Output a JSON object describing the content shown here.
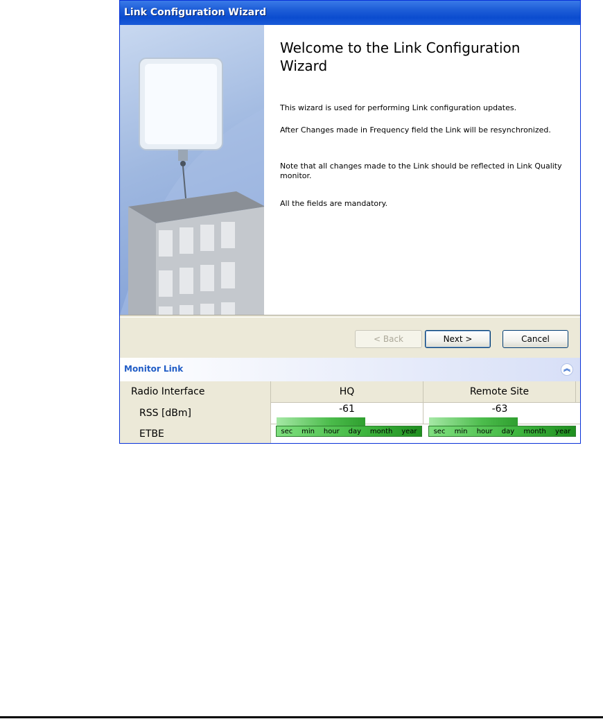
{
  "window": {
    "title": "Link Configuration Wizard"
  },
  "wizard": {
    "heading": "Welcome to the Link Configuration Wizard",
    "paragraphs": [
      "This wizard is used for performing Link configuration updates.",
      "After Changes made in Frequency field the Link will be resynchronized.",
      "Note that all changes made to the Link should be reflected in Link Quality monitor.",
      "All the fields are mandatory."
    ]
  },
  "buttons": {
    "back": "< Back",
    "next": "Next >",
    "cancel": "Cancel"
  },
  "monitor": {
    "title": "Monitor Link",
    "collapse_icon": "double-chevron-up-icon",
    "columns": [
      "Radio Interface",
      "HQ",
      "Remote Site"
    ],
    "rss": {
      "label": "RSS [dBm]",
      "hq": "-61",
      "remote": "-63"
    },
    "etbe": {
      "label": "ETBE",
      "scale_labels": [
        "sec",
        "min",
        "hour",
        "day",
        "month",
        "year"
      ]
    }
  },
  "colors": {
    "titlebar": "#0b4ccf",
    "monitor_title": "#215dc6",
    "bar_green": "#4cbc4c"
  }
}
